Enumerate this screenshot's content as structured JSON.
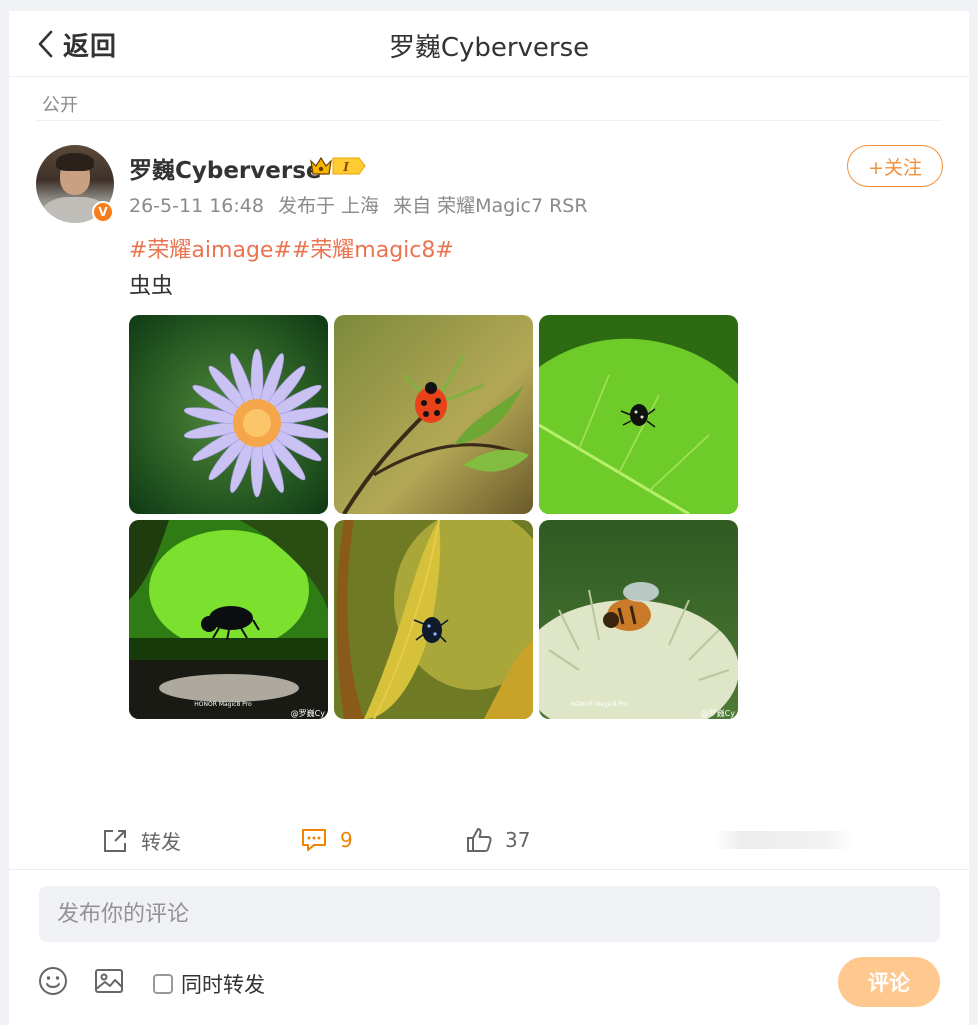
{
  "header": {
    "back_label": "返回",
    "title": "罗巍Cyberverse"
  },
  "visibility": "公开",
  "post": {
    "author": "罗巍Cyberverse",
    "verified_badge": "V",
    "vip_level": "I",
    "follow_label": "+关注",
    "time": "26-5-11 16:48",
    "location": "发布于 上海",
    "source": "来自 荣耀Magic7 RSR",
    "hashtags": "#荣耀aimage##荣耀magic8#",
    "text": "虫虫",
    "images": [
      {
        "subject": "purple-aster-flower",
        "watermark": ""
      },
      {
        "subject": "ladybug-on-plant",
        "watermark": ""
      },
      {
        "subject": "insect-on-green-leaf",
        "watermark": ""
      },
      {
        "subject": "beetle-on-leaf-edge",
        "watermark": "@罗巍Cy"
      },
      {
        "subject": "bug-on-yellow-leaf",
        "watermark": ""
      },
      {
        "subject": "bee-on-white-flower",
        "watermark": "@罗巍Cy"
      }
    ],
    "image_brand": "HONOR Magic8 Pro"
  },
  "actions": {
    "repost_label": "转发",
    "comment_count": "9",
    "like_count": "37"
  },
  "composer": {
    "placeholder": "发布你的评论",
    "also_repost_label": "同时转发",
    "submit_label": "评论"
  },
  "colors": {
    "accent_orange": "#f0913b",
    "hashtag": "#eb7350",
    "comment_active": "#f08300",
    "submit_disabled": "#ffc88f"
  }
}
